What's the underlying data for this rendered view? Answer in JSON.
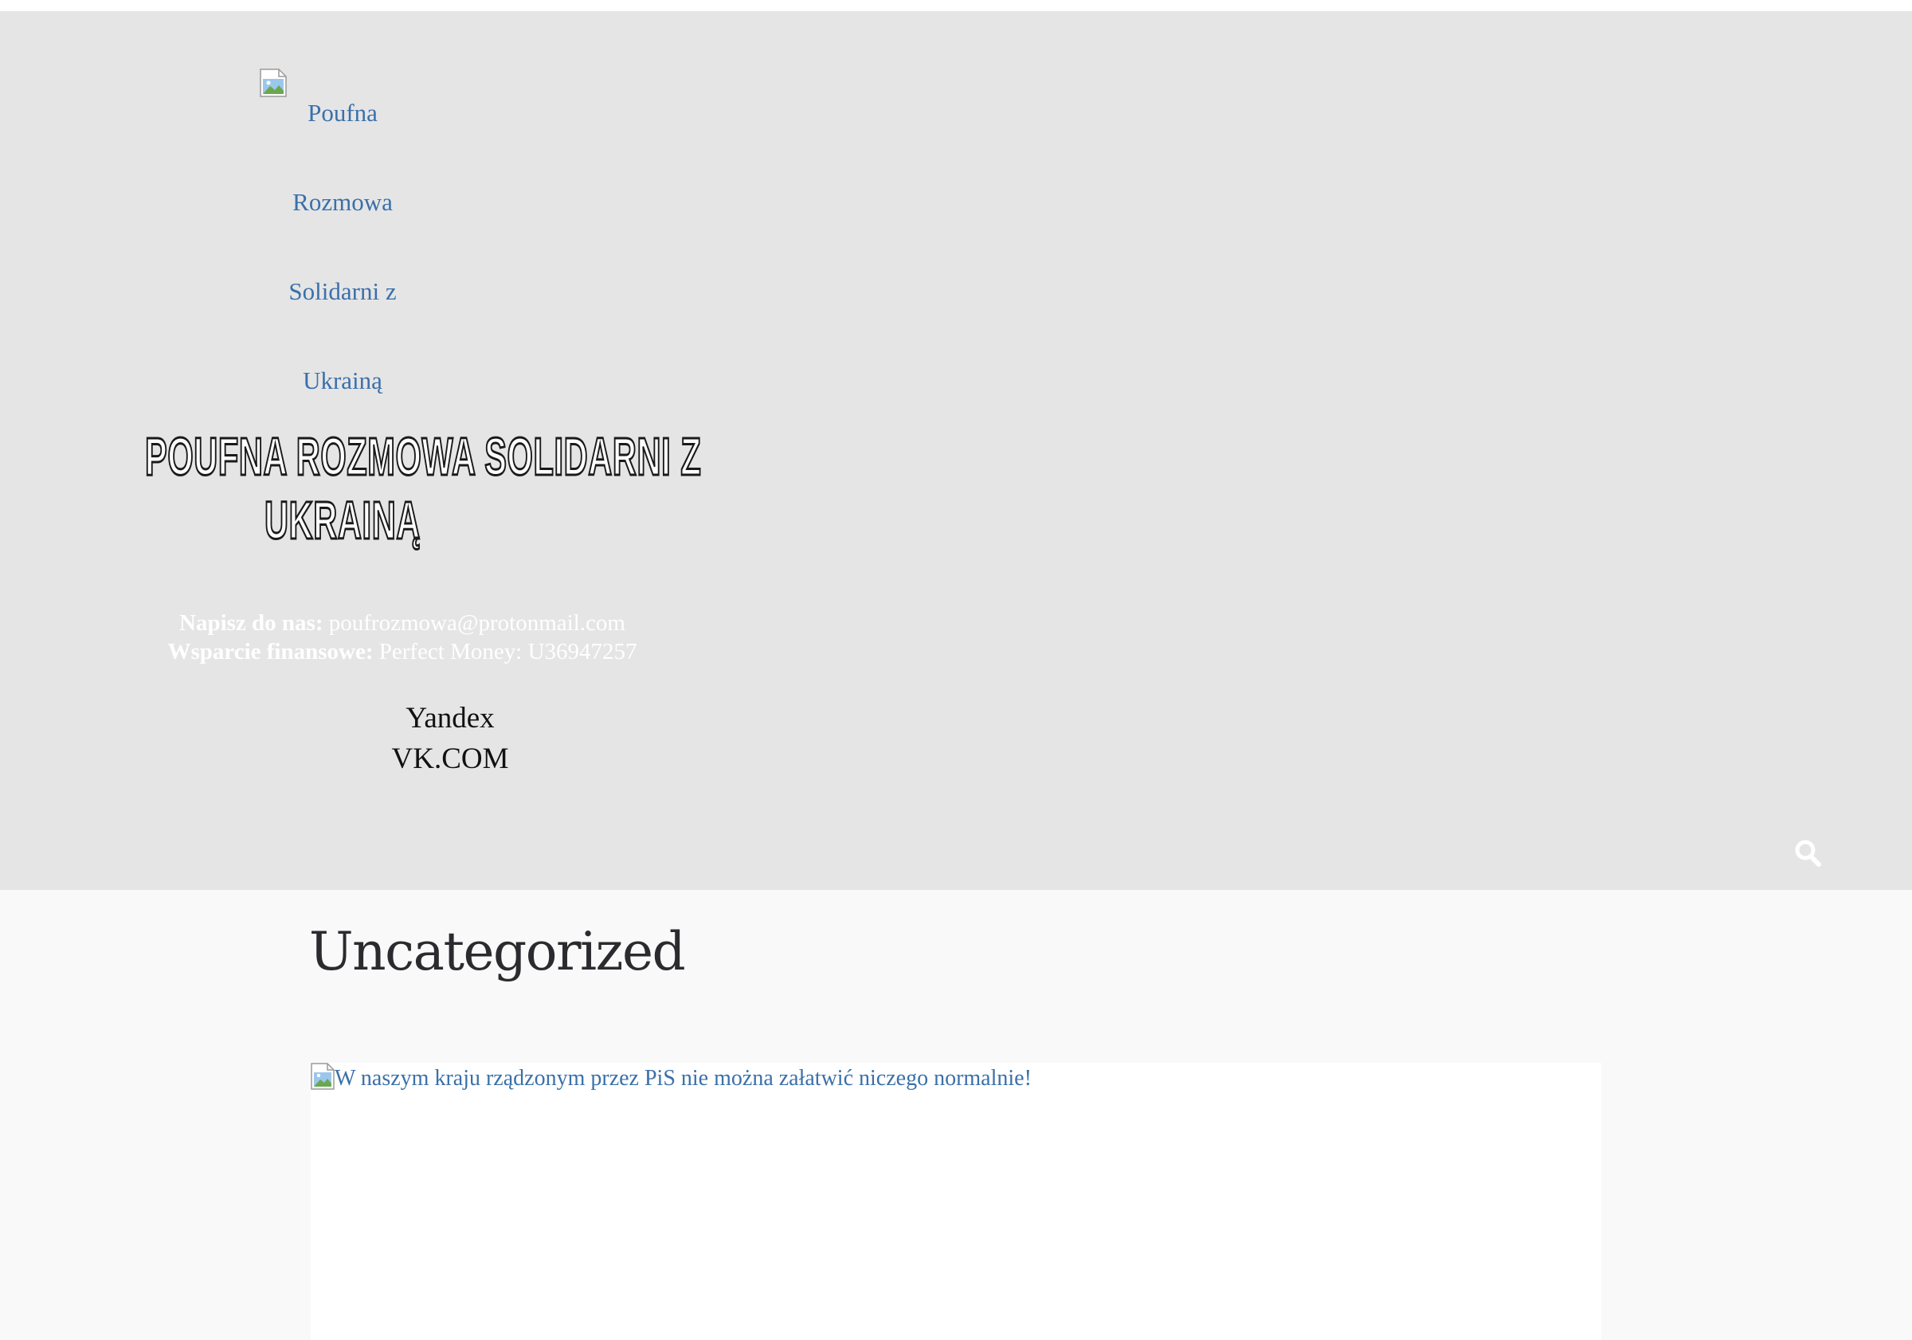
{
  "header": {
    "logo_alt_lines": [
      "Poufna",
      "Rozmowa",
      "Solidarni z",
      "Ukrainą"
    ],
    "site_title_line1": "POUFNA ROZMOWA SOLIDARNI Z",
    "site_title_line2": "UKRAINĄ",
    "contact": {
      "email_label": "Napisz do nas:",
      "email_value": "poufrozmowa@protonmail.com",
      "support_label": "Wsparcie finansowe:",
      "support_value": "Perfect Money: U36947257"
    },
    "links": [
      "Yandex",
      "VK.COM"
    ],
    "search_icon": "search-icon"
  },
  "main": {
    "archive_title": "Uncategorized",
    "post": {
      "thumbnail_alt": "W naszym kraju rządzonym przez PiS nie można załatwić niczego normalnie!"
    }
  },
  "colors": {
    "header_bg": "#e5e5e6",
    "page_bg": "#f9f9f9",
    "link": "#3a70a9",
    "title_text": "#2b2b2f"
  }
}
